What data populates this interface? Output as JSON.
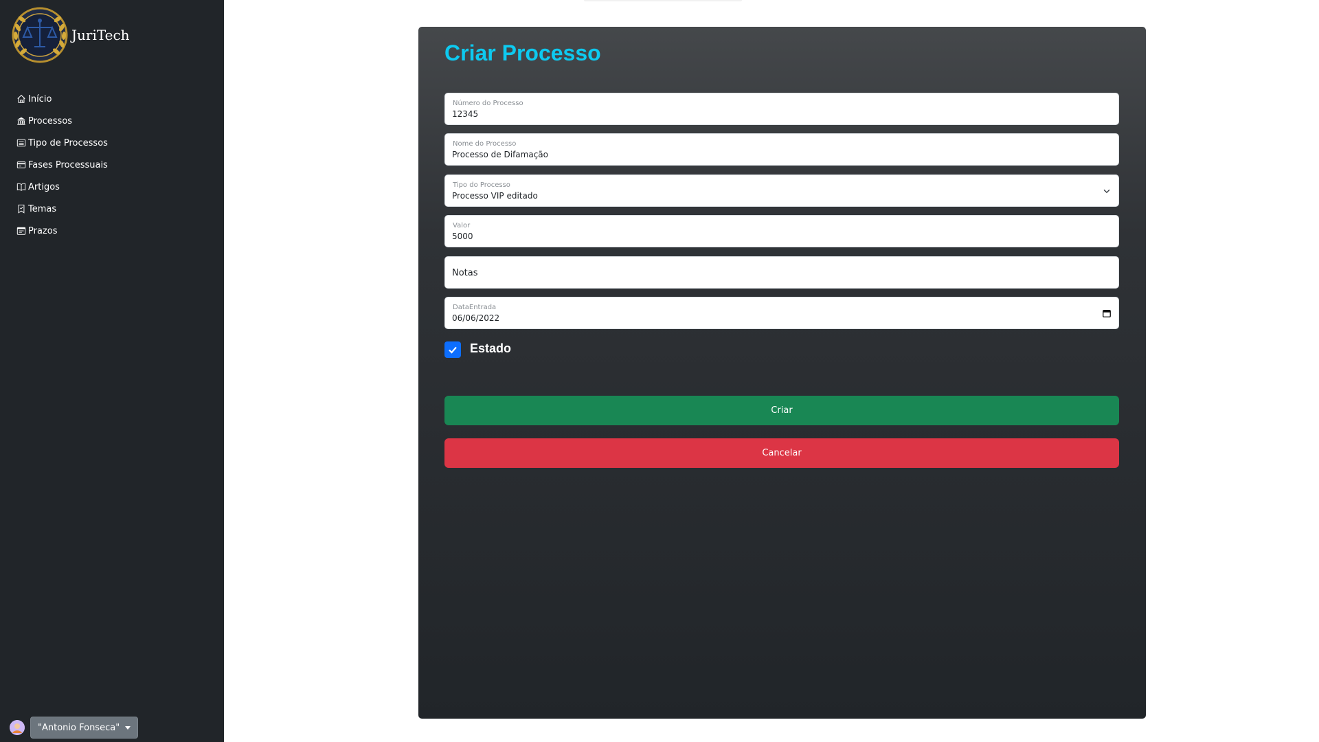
{
  "app": {
    "name": "JuriTech"
  },
  "sidebar": {
    "items": [
      {
        "label": "Início",
        "icon": "house-icon"
      },
      {
        "label": "Processos",
        "icon": "bank-icon"
      },
      {
        "label": "Tipo de Processos",
        "icon": "list-icon"
      },
      {
        "label": "Fases Processuais",
        "icon": "card-icon"
      },
      {
        "label": "Artigos",
        "icon": "book-icon"
      },
      {
        "label": "Temas",
        "icon": "bookmark-icon"
      },
      {
        "label": "Prazos",
        "icon": "calendar-icon"
      }
    ]
  },
  "user": {
    "name": "\"Antonio Fonseca\""
  },
  "form": {
    "title": "Criar Processo",
    "numero": {
      "label": "Número do Processo",
      "value": "12345"
    },
    "nome": {
      "label": "Nome do Processo",
      "value": "Processo de Difamação"
    },
    "tipo": {
      "label": "Tipo do Processo",
      "value": "Processo VIP editado"
    },
    "valor": {
      "label": "Valor",
      "value": "5000"
    },
    "notas": {
      "placeholder": "Notas"
    },
    "data": {
      "label": "DataEntrada",
      "value": "06/06/2022"
    },
    "estado": {
      "label": "Estado",
      "checked": true
    },
    "create_label": "Criar",
    "cancel_label": "Cancelar"
  },
  "colors": {
    "sidebar_bg": "#212529",
    "title": "#0dcaf0",
    "create": "#198754",
    "cancel": "#dc3545",
    "checkbox": "#0d6efd"
  }
}
